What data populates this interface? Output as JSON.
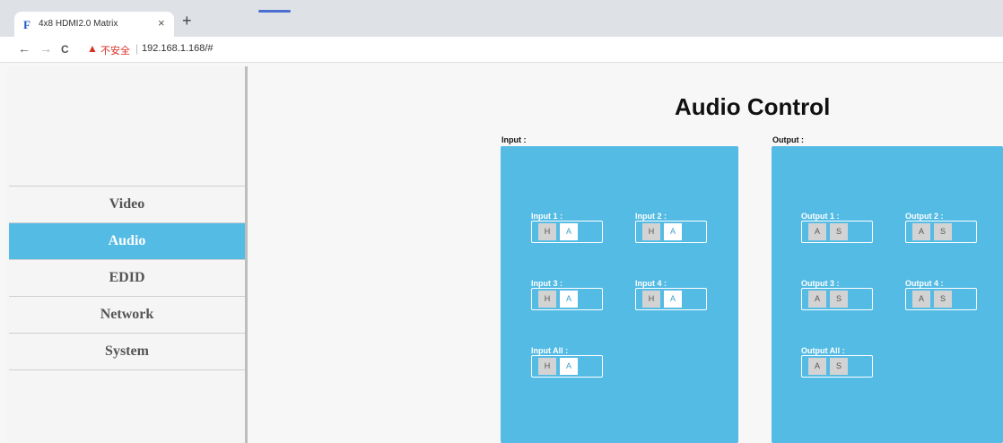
{
  "browser": {
    "tab_favicon": "F",
    "tab_title": "4x8 HDMI2.0 Matrix",
    "tab_close": "×",
    "new_tab": "+",
    "back": "←",
    "forward": "→",
    "reload": "C",
    "security_warning": "不安全",
    "url": "192.168.1.168/#"
  },
  "sidebar": {
    "items": [
      {
        "label": "Video",
        "active": false
      },
      {
        "label": "Audio",
        "active": true
      },
      {
        "label": "EDID",
        "active": false
      },
      {
        "label": "Network",
        "active": false
      },
      {
        "label": "System",
        "active": false
      }
    ]
  },
  "main": {
    "title": "Audio Control",
    "input_section": {
      "label": "Input :",
      "groups": [
        {
          "label": "Input 1 :",
          "buttons": [
            "H",
            "A"
          ]
        },
        {
          "label": "Input 2 :",
          "buttons": [
            "H",
            "A"
          ]
        },
        {
          "label": "Input 3 :",
          "buttons": [
            "H",
            "A"
          ]
        },
        {
          "label": "Input 4 :",
          "buttons": [
            "H",
            "A"
          ]
        },
        {
          "label": "Input All :",
          "buttons": [
            "H",
            "A"
          ]
        }
      ]
    },
    "output_section": {
      "label": "Output :",
      "groups": [
        {
          "label": "Output 1 :",
          "buttons": [
            "A",
            "S"
          ]
        },
        {
          "label": "Output 2 :",
          "buttons": [
            "A",
            "S"
          ]
        },
        {
          "label": "Output 3 :",
          "buttons": [
            "A",
            "S"
          ]
        },
        {
          "label": "Output 4 :",
          "buttons": [
            "A",
            "S"
          ]
        },
        {
          "label": "Output All :",
          "buttons": [
            "A",
            "S"
          ]
        }
      ]
    }
  },
  "colors": {
    "accent": "#54bbe4",
    "warning": "#d93025"
  }
}
